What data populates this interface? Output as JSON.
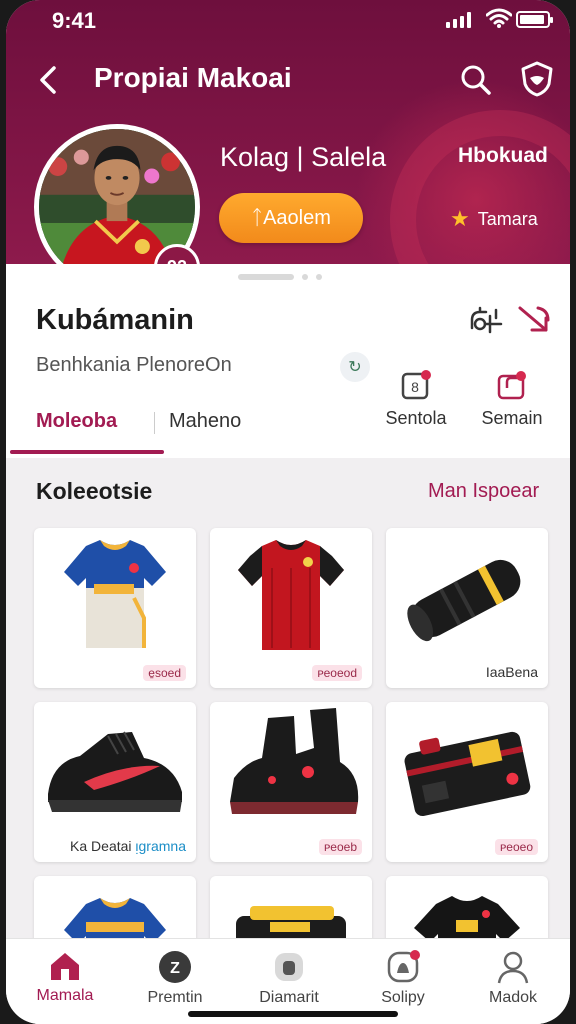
{
  "status": {
    "time": "9:41"
  },
  "header": {
    "title": "Propiai Makoai"
  },
  "hero": {
    "name": "Kolag | Salela",
    "side_label": "Hbokuad",
    "follow_label": "ᛏAaolem",
    "rating_label": "Tamara",
    "jersey_number": "92"
  },
  "profile": {
    "name": "Kubámanin",
    "subtitle": "Benhkania PlenoreOn",
    "chip": "↻"
  },
  "tabs": [
    {
      "label": "Moleoba"
    },
    {
      "label": "Maheno"
    }
  ],
  "quick_actions": [
    {
      "label": "Sentola",
      "icon": "calendar-icon"
    },
    {
      "label": "Semain",
      "icon": "share-box-icon"
    }
  ],
  "collection": {
    "title": "Koleeotsie",
    "link": "Man Ispoear",
    "items": [
      {
        "label_pill": "e̱soed",
        "art": "blue-jersey"
      },
      {
        "label_pill": "ᴘeoeod",
        "art": "red-jersey"
      },
      {
        "label": "IaaBena",
        "art": "black-tube"
      },
      {
        "label": "Ka Deatai",
        "label_blue": "ᴉgramna",
        "art": "black-sneaker"
      },
      {
        "label_pill": "ᴘeoeb",
        "art": "black-boot"
      },
      {
        "label_pill": "ᴘeoeo",
        "art": "gear-bag"
      },
      {
        "art": "blue-jersey-2"
      },
      {
        "art": "yellow-bag"
      },
      {
        "art": "black-shirt"
      }
    ]
  },
  "bottom_nav": [
    {
      "label": "Mamala",
      "icon": "home-icon",
      "active": true
    },
    {
      "label": "Premtin",
      "icon": "ball-icon"
    },
    {
      "label": "Diamarit",
      "icon": "gift-icon"
    },
    {
      "label": "Solipy",
      "icon": "bell-icon"
    },
    {
      "label": "Madok",
      "icon": "user-icon"
    }
  ],
  "colors": {
    "brand": "#8c1846",
    "accent": "#a21b52",
    "button": "#f28a1b"
  }
}
